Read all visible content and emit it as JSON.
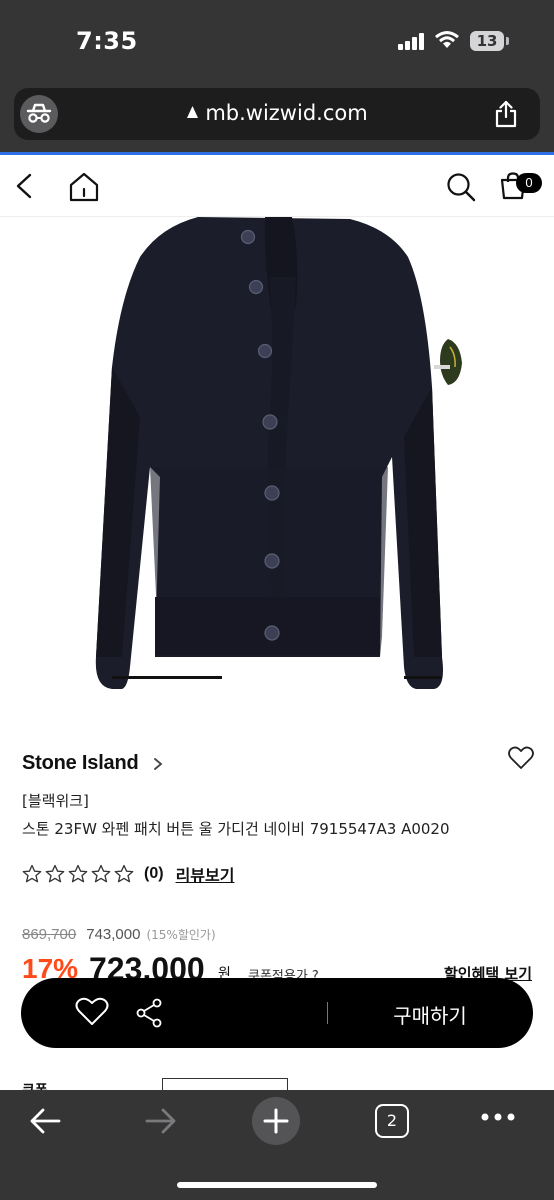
{
  "status_bar": {
    "time": "7:35",
    "battery": "13"
  },
  "browser": {
    "url": "mb.wizwid.com",
    "open_tabs": "2"
  },
  "header": {
    "cart_count": "0"
  },
  "product": {
    "brand": "Stone Island",
    "category": "[블랙위크]",
    "title": "스톤 23FW 와펜 패치 버튼 울 가디건 네이비 7915547A3 A0020",
    "review_count": "(0)",
    "review_link": "리뷰보기",
    "original_price": "869,700",
    "sale_price": "743,000",
    "sale_rate": "(15%할인가)",
    "discount": "17%",
    "final_price": "723,000",
    "currency": "원",
    "coupon_applied": "쿠폰적용가 ?",
    "benefit_link": "할인혜택 보기",
    "coupon_label": "쿠폰"
  },
  "purchase_bar": {
    "buy_label": "구매하기"
  },
  "colors": {
    "accent_discount": "#ff4a1a",
    "chrome": "#353536",
    "load_bar": "#2f6fe6"
  },
  "icons": [
    "spy-icon",
    "lock-icon",
    "share-icon",
    "back-icon",
    "home-icon",
    "search-icon",
    "cart-icon",
    "wishlist-heart-icon",
    "star-icon",
    "chevron-right-icon",
    "arrow-left-icon",
    "arrow-right-icon",
    "plus-icon",
    "tabs-icon",
    "more-icon"
  ]
}
